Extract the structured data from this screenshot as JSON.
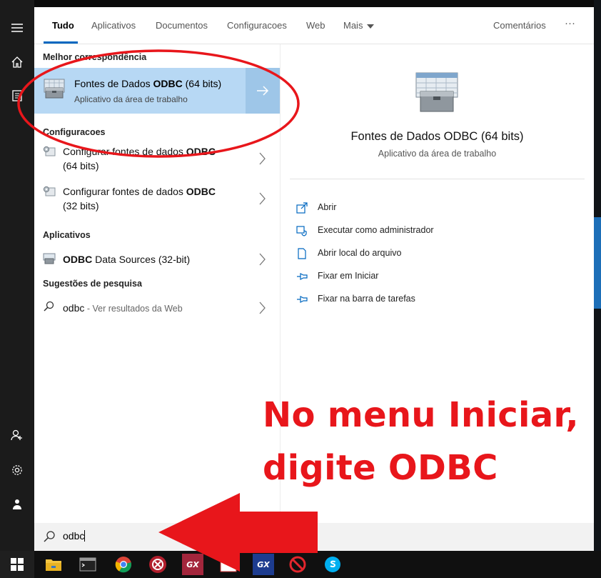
{
  "tabs": [
    {
      "label": "Tudo",
      "active": true
    },
    {
      "label": "Aplicativos"
    },
    {
      "label": "Documentos"
    },
    {
      "label": "Configuracoes"
    },
    {
      "label": "Web"
    },
    {
      "label": "Mais"
    }
  ],
  "feedback_label": "Comentários",
  "more_label": "···",
  "sections": {
    "best_match": "Melhor correspondência",
    "settings": "Configuracoes",
    "apps": "Aplicativos",
    "suggestions": "Sugestões de pesquisa"
  },
  "best_match": {
    "title_pre": "Fontes de Dados ",
    "title_bold": "ODBC",
    "title_post": " (64 bits)",
    "subtitle": "Aplicativo da área de trabalho"
  },
  "settings_items": [
    {
      "pre": "Configurar fontes de dados ",
      "bold": "ODBC",
      "line2": "(64 bits)"
    },
    {
      "pre": "Configurar fontes de dados ",
      "bold": "ODBC",
      "line2": "(32 bits)"
    }
  ],
  "app_item": {
    "bold": "ODBC",
    "post": " Data Sources (32-bit)"
  },
  "suggestion": {
    "query": "odbc",
    "sub": " - Ver resultados da Web"
  },
  "preview": {
    "title": "Fontes de Dados ODBC (64 bits)",
    "subtitle": "Aplicativo da área de trabalho",
    "actions": [
      {
        "label": "Abrir",
        "icon": "open-icon"
      },
      {
        "label": "Executar como administrador",
        "icon": "shield-icon"
      },
      {
        "label": "Abrir local do arquivo",
        "icon": "file-icon"
      },
      {
        "label": "Fixar em Iniciar",
        "icon": "pin-icon"
      },
      {
        "label": "Fixar na barra de tarefas",
        "icon": "pin-icon"
      }
    ]
  },
  "search": {
    "value": "odbc"
  },
  "annotation": {
    "line1": "No menu Iniciar,",
    "line2": "digite ODBC"
  },
  "taskbar": {
    "gx1": "GX",
    "gx2": "GX"
  },
  "colors": {
    "accent": "#0067c0",
    "highlight": "#b7d8f4",
    "annotation": "#e8161b"
  }
}
